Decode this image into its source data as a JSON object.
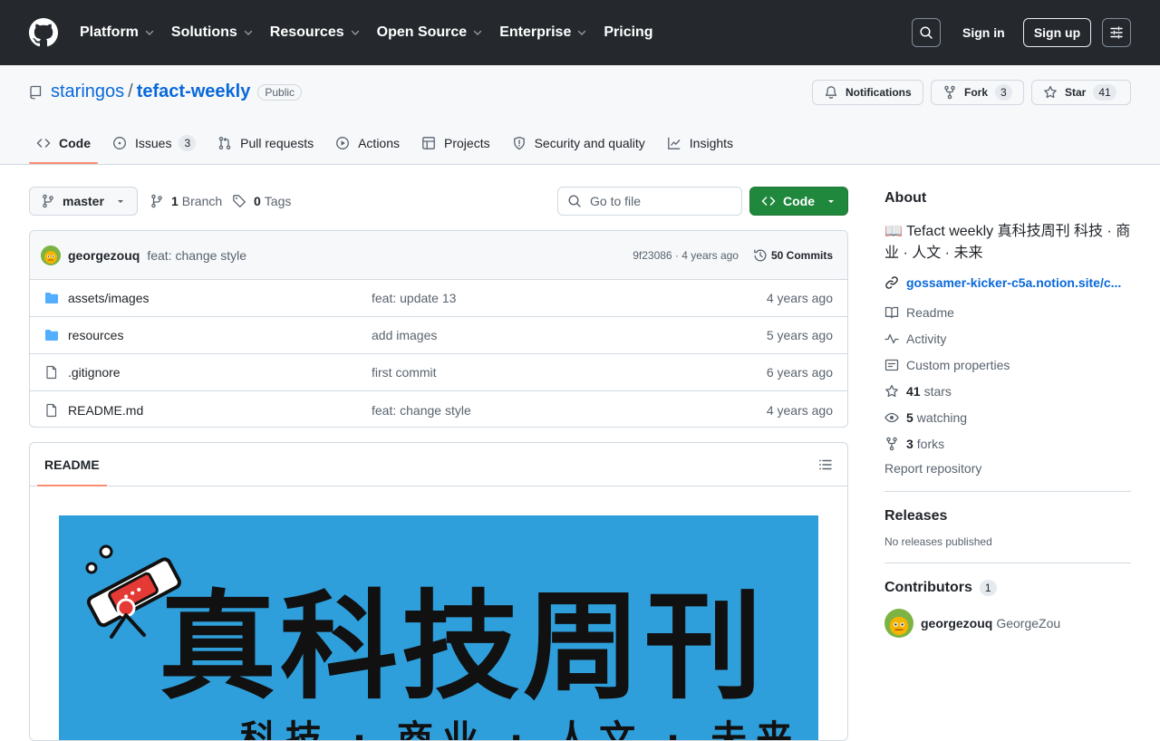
{
  "header": {
    "nav": [
      {
        "label": "Platform",
        "dropdown": true
      },
      {
        "label": "Solutions",
        "dropdown": true
      },
      {
        "label": "Resources",
        "dropdown": true
      },
      {
        "label": "Open Source",
        "dropdown": true
      },
      {
        "label": "Enterprise",
        "dropdown": true
      },
      {
        "label": "Pricing",
        "dropdown": false
      }
    ],
    "sign_in": "Sign in",
    "sign_up": "Sign up"
  },
  "repo": {
    "owner": "staringos",
    "separator": "/",
    "name": "tefact-weekly",
    "visibility": "Public",
    "notifications_label": "Notifications",
    "fork_label": "Fork",
    "fork_count": "3",
    "star_label": "Star",
    "star_count": "41"
  },
  "tabs": [
    {
      "label": "Code",
      "icon": "code-icon",
      "selected": true,
      "count": ""
    },
    {
      "label": "Issues",
      "icon": "issue-icon",
      "selected": false,
      "count": "3"
    },
    {
      "label": "Pull requests",
      "icon": "pull-request-icon",
      "selected": false,
      "count": ""
    },
    {
      "label": "Actions",
      "icon": "play-icon",
      "selected": false,
      "count": ""
    },
    {
      "label": "Projects",
      "icon": "table-icon",
      "selected": false,
      "count": ""
    },
    {
      "label": "Security and quality",
      "icon": "shield-icon",
      "selected": false,
      "count": ""
    },
    {
      "label": "Insights",
      "icon": "graph-icon",
      "selected": false,
      "count": ""
    }
  ],
  "toolbar": {
    "branch": "master",
    "branch_count": "1",
    "branch_label": "Branch",
    "tag_count": "0",
    "tag_label": "Tags",
    "goto_file_placeholder": "Go to file",
    "code_button": "Code"
  },
  "latest_commit": {
    "author": "georgezouq",
    "message": "feat: change style",
    "hash": "9f23086",
    "time": "4 years ago",
    "hash_time": "9f23086 · 4 years ago",
    "commits_label": "50 Commits"
  },
  "files": [
    {
      "type": "folder",
      "name": "assets/images",
      "message": "feat: update 13",
      "age": "4 years ago"
    },
    {
      "type": "folder",
      "name": "resources",
      "message": "add images",
      "age": "5 years ago"
    },
    {
      "type": "file",
      "name": ".gitignore",
      "message": "first commit",
      "age": "6 years ago"
    },
    {
      "type": "file",
      "name": "README.md",
      "message": "feat: change style",
      "age": "4 years ago"
    }
  ],
  "readme": {
    "tab_label": "README",
    "banner_title": "真科技周刊",
    "banner_subtitle": "科技 · 商业 · 人文 · 未来"
  },
  "sidebar": {
    "about_title": "About",
    "description": "📖 Tefact weekly 真科技周刊 科技 · 商业 · 人文 · 未来",
    "website": "gossamer-kicker-c5a.notion.site/c...",
    "items": {
      "readme": "Readme",
      "activity": "Activity",
      "custom_properties": "Custom properties",
      "stars_count": "41",
      "stars_label": "stars",
      "watching_count": "5",
      "watching_label": "watching",
      "forks_count": "3",
      "forks_label": "forks"
    },
    "report": "Report repository",
    "releases_title": "Releases",
    "releases_empty": "No releases published",
    "contributors_title": "Contributors",
    "contributors_count": "1",
    "contributor_login": "georgezouq",
    "contributor_name": "GeorgeZou"
  },
  "colors": {
    "header_bg": "#25292e",
    "link": "#0969da",
    "primary_button": "#1f883d",
    "tab_underline": "#fd8c73",
    "banner_bg": "#2f9fdb",
    "folder": "#54aeff"
  }
}
